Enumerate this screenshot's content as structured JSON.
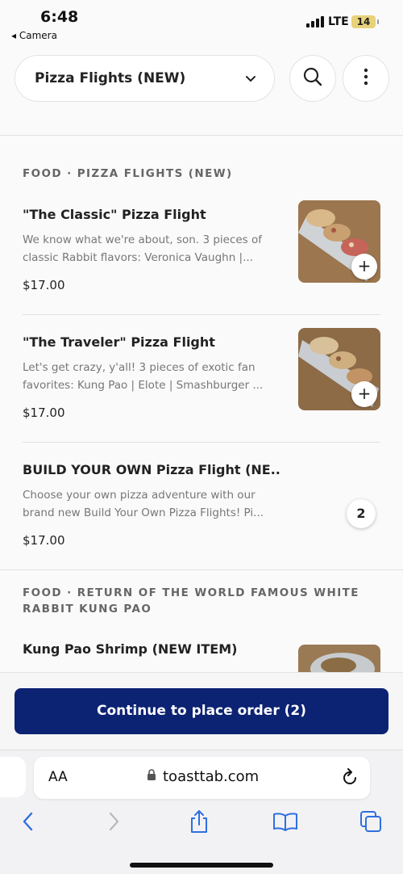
{
  "status": {
    "time": "6:48",
    "back_app": "◂ Camera",
    "network": "LTE",
    "battery": "14"
  },
  "header": {
    "menu_select": "Pizza Flights (NEW)"
  },
  "sections": [
    {
      "title": "FOOD · PIZZA FLIGHTS (NEW)"
    },
    {
      "title": "FOOD · RETURN OF THE WORLD FAMOUS WHITE RABBIT KUNG PAO"
    }
  ],
  "items": [
    {
      "name": "\"The Classic\" Pizza Flight",
      "desc": "We know what we're about, son. 3 pieces of classic Rabbit flavors: Veronica Vaughn |...",
      "price": "$17.00",
      "action": "+"
    },
    {
      "name": "\"The Traveler\" Pizza Flight",
      "desc": "Let's get crazy, y'all! 3 pieces of exotic fan favorites: Kung Pao | Elote | Smashburger ...",
      "price": "$17.00",
      "action": "+"
    },
    {
      "name": "BUILD YOUR OWN Pizza Flight (NE...",
      "desc": "Choose your own pizza adventure with our brand new Build Your Own Pizza Flights! Pi...",
      "price": "$17.00",
      "quantity": "2"
    },
    {
      "name": "Kung Pao Shrimp (NEW ITEM)"
    }
  ],
  "order": {
    "button_label": "Continue to place order (2)"
  },
  "browser": {
    "text_size": "AA",
    "url": "toasttab.com"
  },
  "colors": {
    "primary": "#0c2373",
    "background": "#fafafa"
  }
}
